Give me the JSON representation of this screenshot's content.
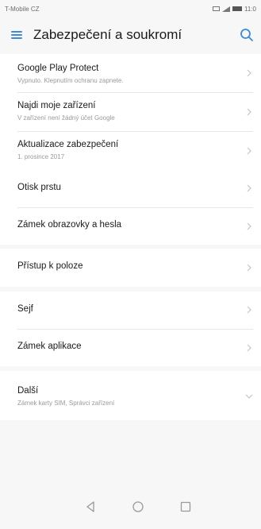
{
  "status_bar": {
    "carrier": "T-Mobile CZ",
    "time": "11:0"
  },
  "header": {
    "title": "Zabezpečení a soukromí"
  },
  "items": [
    {
      "label": "Google Play Protect",
      "sub": "Vypnuto. Klepnutím ochranu zapnete."
    },
    {
      "label": "Najdi moje zařízení",
      "sub": "V zařízení není žádný účet Google"
    },
    {
      "label": "Aktualizace zabezpečení",
      "sub": "1. prosince 2017"
    },
    {
      "label": "Otisk prstu"
    },
    {
      "label": "Zámek obrazovky a hesla"
    },
    {
      "label": "Přístup k poloze"
    },
    {
      "label": "Sejf"
    },
    {
      "label": "Zámek aplikace"
    },
    {
      "label": "Další",
      "sub": "Zámek karty SIM, Správci zařízení"
    }
  ],
  "icons": {
    "menu": "menu-icon",
    "search": "search-icon",
    "chevron_right": "chevron-right-icon",
    "chevron_down": "chevron-down-icon",
    "back": "back-icon",
    "home": "home-icon",
    "recents": "recents-icon"
  },
  "colors": {
    "accent": "#3d8bd6",
    "background": "#f7f7f7",
    "card": "#ffffff"
  }
}
